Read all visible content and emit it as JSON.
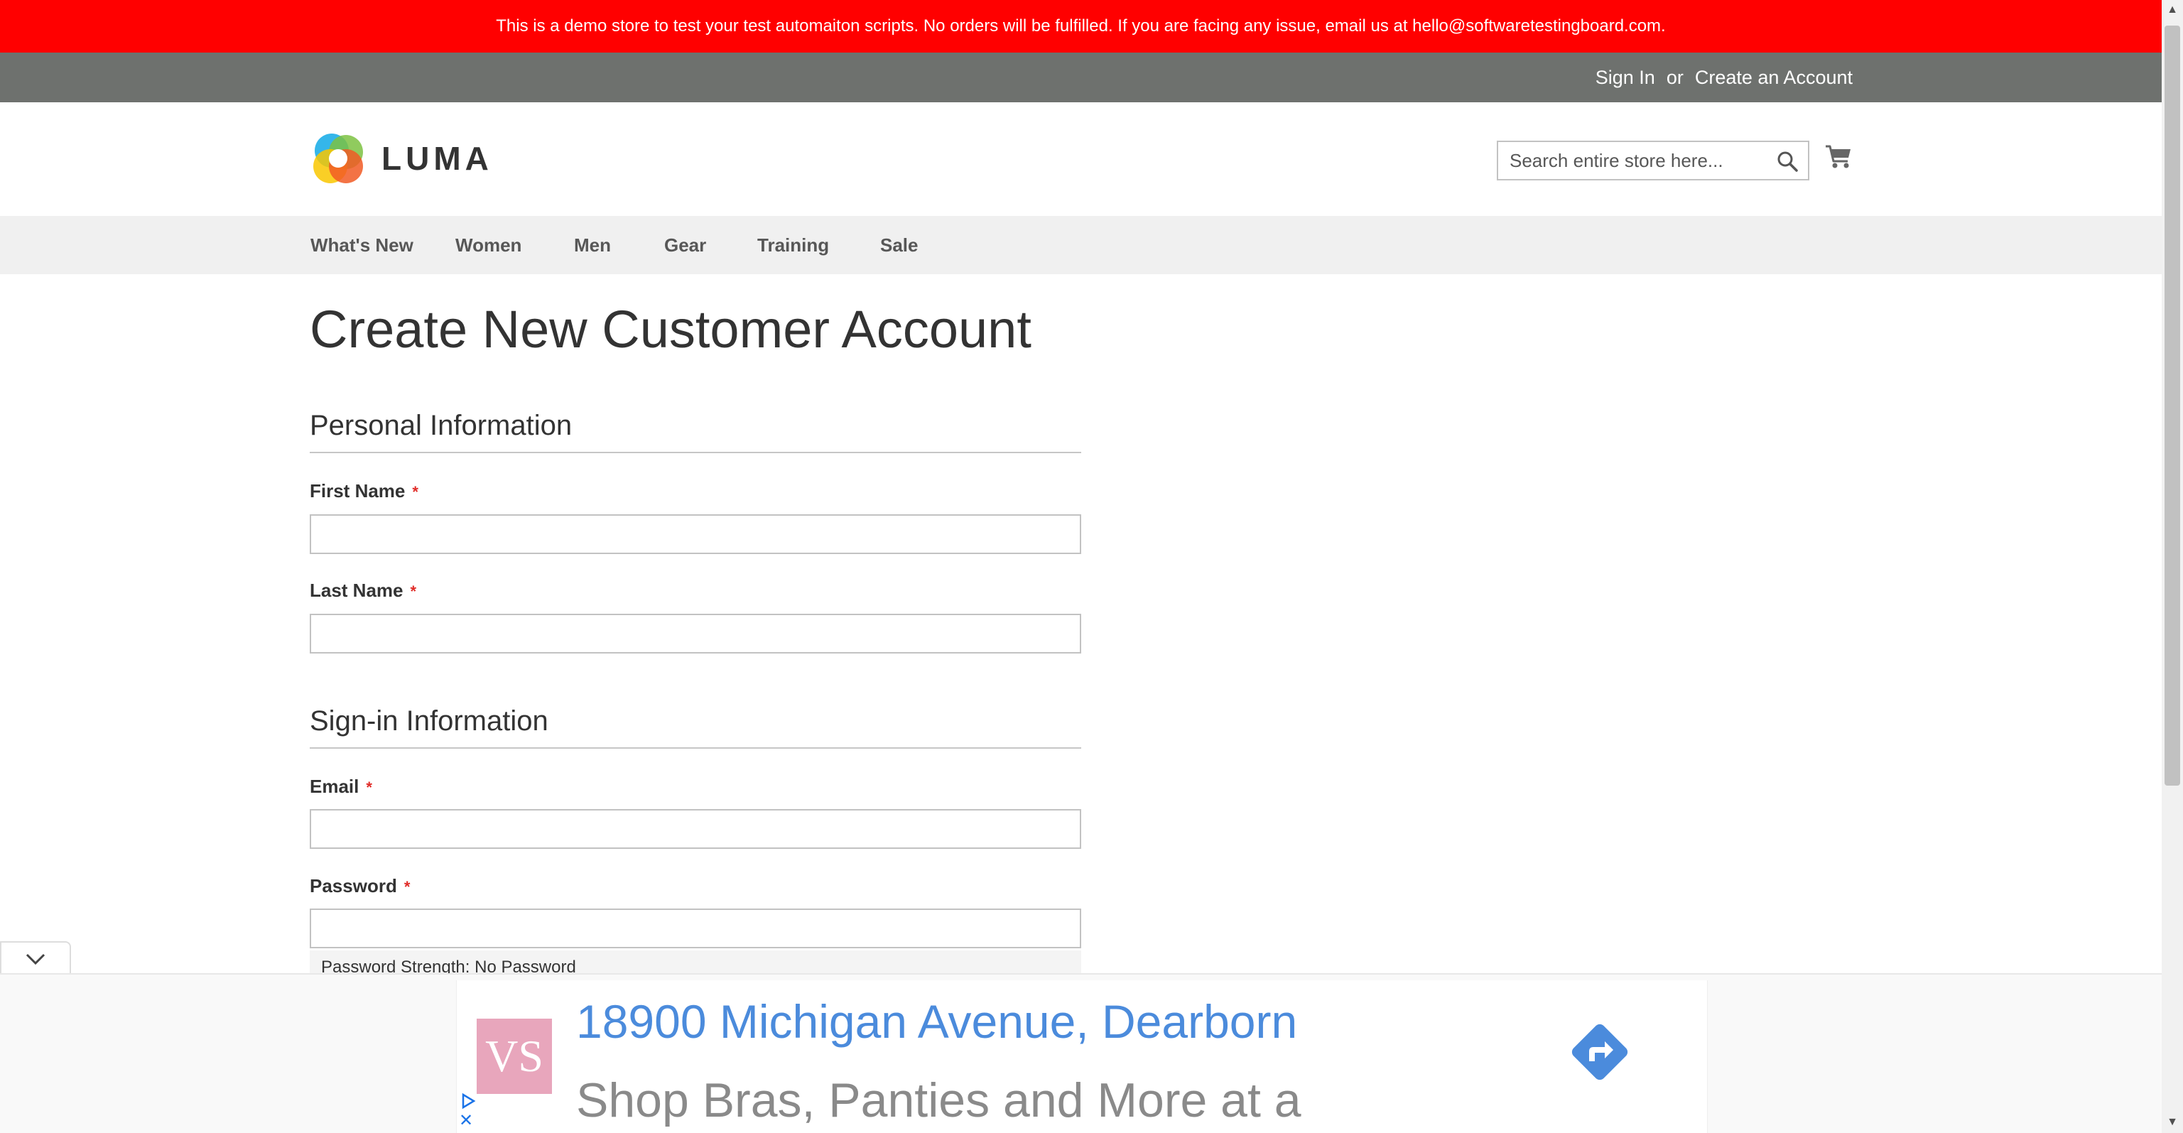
{
  "banner": {
    "text": "This is a demo store to test your test automaiton scripts. No orders will be fulfilled. If you are facing any issue, email us at hello@softwaretestingboard.com."
  },
  "header": {
    "sign_in": "Sign In",
    "or": "or",
    "create_account": "Create an Account",
    "logo_text": "LUMA",
    "search_placeholder": "Search entire store here...",
    "search_icon": "search-icon",
    "cart_icon": "cart-icon"
  },
  "nav": {
    "items": [
      "What's New",
      "Women",
      "Men",
      "Gear",
      "Training",
      "Sale"
    ]
  },
  "page": {
    "title": "Create New Customer Account",
    "personal_section": "Personal Information",
    "signin_section": "Sign-in Information",
    "required_marker": "*",
    "fields": {
      "first_name": {
        "label": "First Name",
        "value": ""
      },
      "last_name": {
        "label": "Last Name",
        "value": ""
      },
      "email": {
        "label": "Email",
        "value": ""
      },
      "password": {
        "label": "Password",
        "value": ""
      }
    },
    "password_strength": "Password Strength: No Password"
  },
  "ad": {
    "address": "18900 Michigan Avenue, Dearborn",
    "subtext": "Shop Bras, Panties and More at a",
    "logo_text": "VS",
    "brand_color": "#e8a6bc",
    "link_color": "#4b8bdc",
    "directions_icon": "directions-icon",
    "collapse_icon": "chevron-down-icon",
    "close_glyph": "✕"
  },
  "colors": {
    "banner": "#ff0000",
    "header_bar": "#6e716e",
    "nav_bg": "#f0f0f0",
    "required": "#e02b27"
  }
}
